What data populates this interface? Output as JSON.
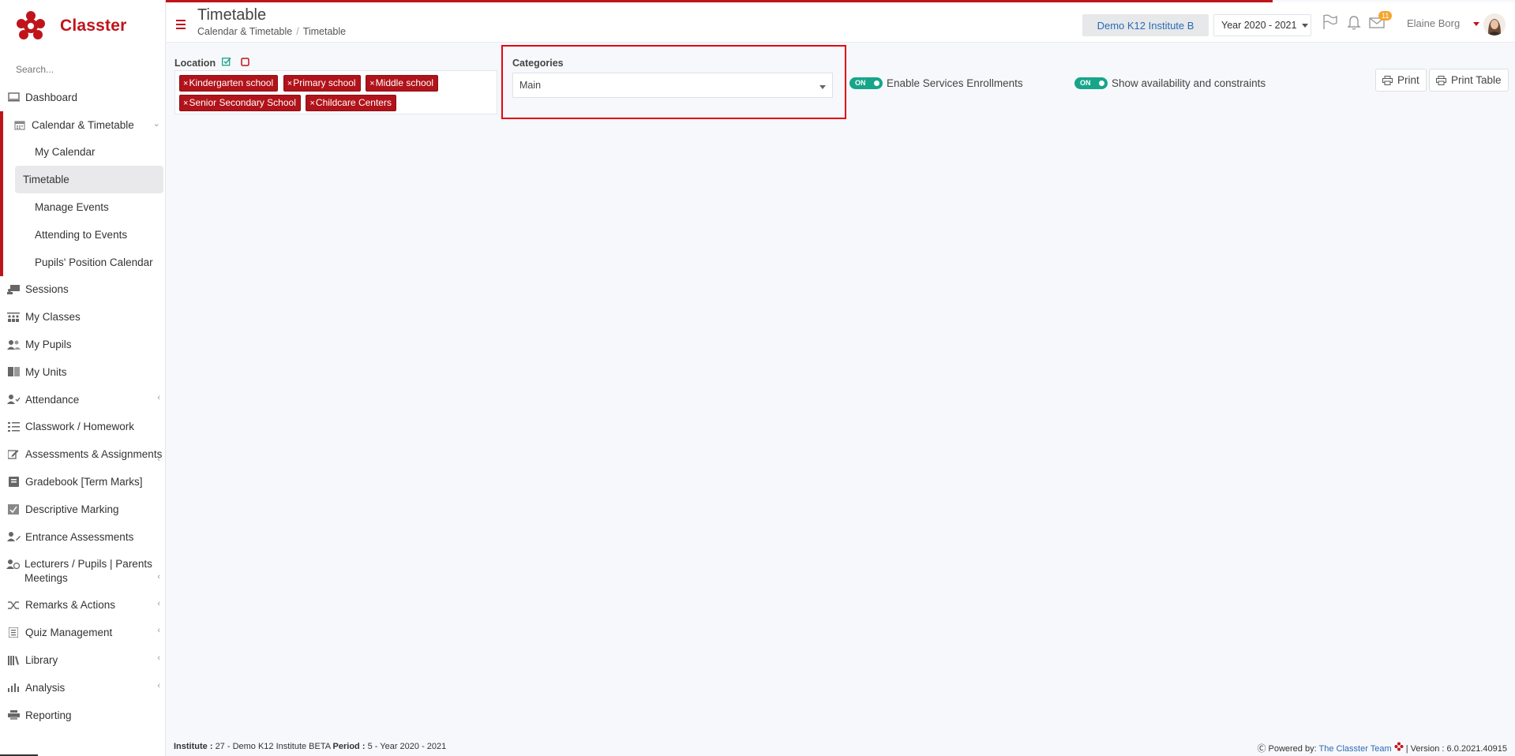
{
  "brand": {
    "name": "Classter"
  },
  "search": {
    "placeholder": "Search..."
  },
  "sidebar": {
    "items_top": [
      {
        "label": "Dashboard"
      }
    ],
    "group": {
      "label": "Calendar & Timetable",
      "children": [
        {
          "label": "My Calendar"
        },
        {
          "label": "Timetable"
        },
        {
          "label": "Manage Events"
        },
        {
          "label": "Attending to Events"
        },
        {
          "label": "Pupils' Position Calendar"
        }
      ]
    },
    "items": [
      {
        "label": "Sessions"
      },
      {
        "label": "My Classes"
      },
      {
        "label": "My Pupils"
      },
      {
        "label": "My Units"
      },
      {
        "label": "Attendance"
      },
      {
        "label": "Classwork / Homework"
      },
      {
        "label": "Assessments & Assignments"
      },
      {
        "label": "Gradebook [Term Marks]"
      },
      {
        "label": "Descriptive Marking"
      },
      {
        "label": "Entrance Assessments"
      },
      {
        "label": "Lecturers / Pupils | Parents Meetings"
      },
      {
        "label": "Remarks & Actions"
      },
      {
        "label": "Quiz Management"
      },
      {
        "label": "Library"
      },
      {
        "label": "Analysis"
      },
      {
        "label": "Reporting"
      }
    ]
  },
  "header": {
    "title": "Timetable",
    "breadcrumb": [
      "Calendar & Timetable",
      "Timetable"
    ],
    "institute": "Demo K12 Institute B",
    "year": "Year 2020 - 2021",
    "messages_count": "11",
    "user": "Elaine Borg"
  },
  "filters": {
    "location_label": "Location",
    "locations": [
      "Kindergarten school",
      "Primary school",
      "Middle school",
      "Senior Secondary School",
      "Childcare Centers"
    ],
    "categories_label": "Categories",
    "categories_value": "Main",
    "toggle_on": "ON",
    "enable_services": "Enable Services Enrollments",
    "show_availability": "Show availability and constraints"
  },
  "toolbar": {
    "print": "Print",
    "print_table": "Print Table"
  },
  "footer": {
    "institute_label": "Institute :",
    "institute_value": "27 - Demo K12 Institute BETA",
    "period_label": "Period :",
    "period_value": "5 - Year 2020 - 2021",
    "powered_by": "Powered by:",
    "team": "The Classter Team",
    "version": "| Version : 6.0.2021.40915"
  },
  "colors": {
    "brand": "#c0141b",
    "toggle": "#17a58a",
    "highlight": "#e30613",
    "link": "#2a6bb5"
  }
}
